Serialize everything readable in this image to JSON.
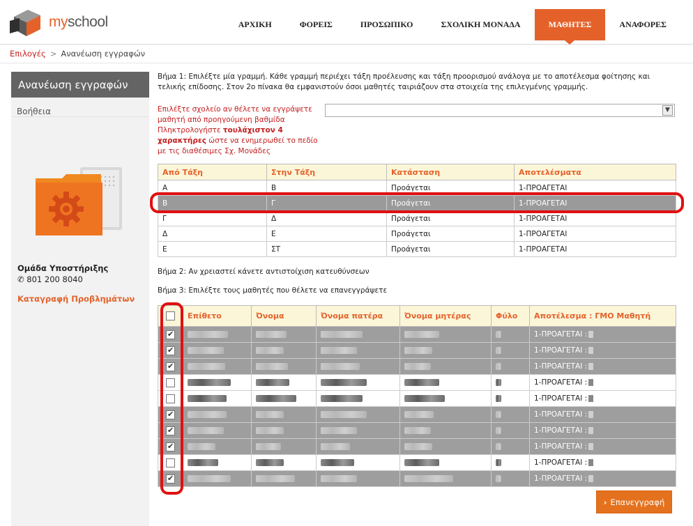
{
  "header": {
    "brand": "myschool",
    "nav": [
      {
        "label": "ΑΡΧΙΚΗ",
        "active": false
      },
      {
        "label": "ΦΟΡΕΙΣ",
        "active": false
      },
      {
        "label": "ΠΡΟΣΩΠΙΚΟ",
        "active": false
      },
      {
        "label": "ΣΧΟΛΙΚΗ ΜΟΝΑΔΑ",
        "active": false
      },
      {
        "label": "ΜΑΘΗΤΕΣ",
        "active": true
      },
      {
        "label": "ΑΝΑΦΟΡΕΣ",
        "active": false
      }
    ]
  },
  "breadcrumb": {
    "link": "Επιλογές",
    "separator": ">",
    "current": "Ανανέωση εγγραφών"
  },
  "sidebar": {
    "title": "Ανανέωση εγγραφών",
    "help": "Βοήθεια",
    "support_title": "Ομάδα Υποστήριξης",
    "support_phone": "801 200 8040",
    "support_link": "Καταγραφή Προβλημάτων"
  },
  "main": {
    "step1": "Βήμα 1: Επιλέξτε μία γραμμή. Κάθε γραμμή περιέχει τάξη προέλευσης και τάξη προορισμού ανάλογα με το αποτέλεσμα φοίτησης και τελικής επίδοσης. Στον 2ο πίνακα θα εμφανιστούν όσοι μαθητές ταιριάζουν στα στοιχεία της επιλεγμένης γραμμής.",
    "school_label_1": "Επιλέξτε σχολείο αν θέλετε να εγγράψετε μαθητή από προηγούμενη βαθμίδα Πληκτρολογήστε ",
    "school_label_bold": "τουλάχιστον 4 χαρακτήρες",
    "school_label_2": " ώστε να ενημερωθεί το πεδίο με τις διαθέσιμες Σχ. Μονάδες",
    "school_select_value": "",
    "step2": "Βήμα 2: Αν χρειαστεί κάνετε αντιστοίχιση κατευθύνσεων",
    "step3": "Βήμα 3: Επιλέξτε τους μαθητές που θέλετε να επανεγγράψετε",
    "submit_label": "Επανεγγραφή"
  },
  "classes_table": {
    "headers": [
      "Από Τάξη",
      "Στην Τάξη",
      "Κατάσταση",
      "Αποτελέσματα"
    ],
    "rows": [
      {
        "from": "Α",
        "to": "Β",
        "status": "Προάγεται",
        "result": "1-ΠΡΟΑΓΕΤΑΙ",
        "selected": false
      },
      {
        "from": "Β",
        "to": "Γ",
        "status": "Προάγεται",
        "result": "1-ΠΡΟΑΓΕΤΑΙ",
        "selected": true
      },
      {
        "from": "Γ",
        "to": "Δ",
        "status": "Προάγεται",
        "result": "1-ΠΡΟΑΓΕΤΑΙ",
        "selected": false
      },
      {
        "from": "Δ",
        "to": "Ε",
        "status": "Προάγεται",
        "result": "1-ΠΡΟΑΓΕΤΑΙ",
        "selected": false
      },
      {
        "from": "Ε",
        "to": "ΣΤ",
        "status": "Προάγεται",
        "result": "1-ΠΡΟΑΓΕΤΑΙ",
        "selected": false
      }
    ]
  },
  "students_table": {
    "headers": [
      "Επίθετο",
      "Όνομα",
      "Όνομα πατέρα",
      "Όνομα μητέρας",
      "Φύλο",
      "Αποτέλεσμα : ΓΜΟ Μαθητή"
    ],
    "header_checked": false,
    "rows": [
      {
        "checked": true,
        "result": "1-ΠΡΟΑΓΕΤΑΙ :"
      },
      {
        "checked": true,
        "result": "1-ΠΡΟΑΓΕΤΑΙ :"
      },
      {
        "checked": true,
        "result": "1-ΠΡΟΑΓΕΤΑΙ :"
      },
      {
        "checked": false,
        "result": "1-ΠΡΟΑΓΕΤΑΙ :"
      },
      {
        "checked": false,
        "result": "1-ΠΡΟΑΓΕΤΑΙ :"
      },
      {
        "checked": true,
        "result": "1-ΠΡΟΑΓΕΤΑΙ :"
      },
      {
        "checked": true,
        "result": "1-ΠΡΟΑΓΕΤΑΙ :"
      },
      {
        "checked": true,
        "result": "1-ΠΡΟΑΓΕΤΑΙ :"
      },
      {
        "checked": false,
        "result": "1-ΠΡΟΑΓΕΤΑΙ :"
      },
      {
        "checked": true,
        "result": "1-ΠΡΟΑΓΕΤΑΙ :"
      }
    ]
  },
  "colors": {
    "accent": "#e4622a",
    "highlight": "#e01010",
    "selected_row": "#9a9a9a"
  }
}
